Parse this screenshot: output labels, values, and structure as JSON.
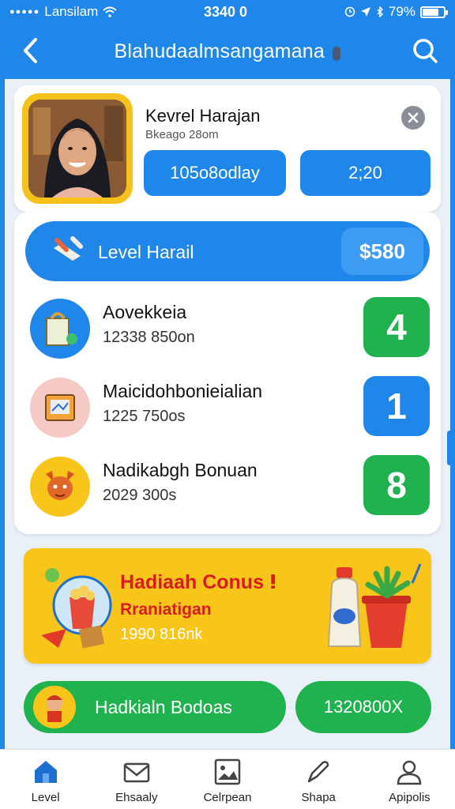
{
  "status_bar": {
    "carrier": "Lansilam",
    "time": "3340 0",
    "battery_percent": "79%"
  },
  "header": {
    "title": "Blahudaalmsangamana"
  },
  "profile": {
    "name": "Kevrel Harajan",
    "subtitle": "Bkeago 28om",
    "stat_left": "105o8odlay",
    "stat_right": "2;20"
  },
  "level_bar": {
    "label": "Level Harail",
    "value": "$580"
  },
  "list": [
    {
      "title": "Aovekkeia",
      "subtitle": "12338 850on",
      "count": "4",
      "color": "#1fb24f",
      "icon_bg": "#1f86ea"
    },
    {
      "title": "Maicidohbonieialian",
      "subtitle": "1225 750os",
      "count": "1",
      "color": "#1f86ea",
      "icon_bg": "#f5c9c4"
    },
    {
      "title": "Nadikabgh Bonuan",
      "subtitle": "2029 300s",
      "count": "8",
      "color": "#1fb24f",
      "icon_bg": "#f8c51b"
    }
  ],
  "bonus": {
    "title": "Hadiaah Conus",
    "subtitle": "Rraniatigan",
    "value": "1990 816nk"
  },
  "bottom": {
    "left_label": "Hadkialn Bodoas",
    "right_label": "1320800X"
  },
  "tabs": [
    {
      "label": "Level",
      "icon": "home-icon",
      "active": true
    },
    {
      "label": "Ehsaaly",
      "icon": "mail-icon",
      "active": false
    },
    {
      "label": "Celrpean",
      "icon": "image-icon",
      "active": false
    },
    {
      "label": "Shapa",
      "icon": "pen-icon",
      "active": false
    },
    {
      "label": "Apipolis",
      "icon": "user-icon",
      "active": false
    }
  ],
  "colors": {
    "primary": "#1f86ea",
    "green": "#1fb24f",
    "yellow": "#f8c51b",
    "red": "#d81b1b"
  }
}
